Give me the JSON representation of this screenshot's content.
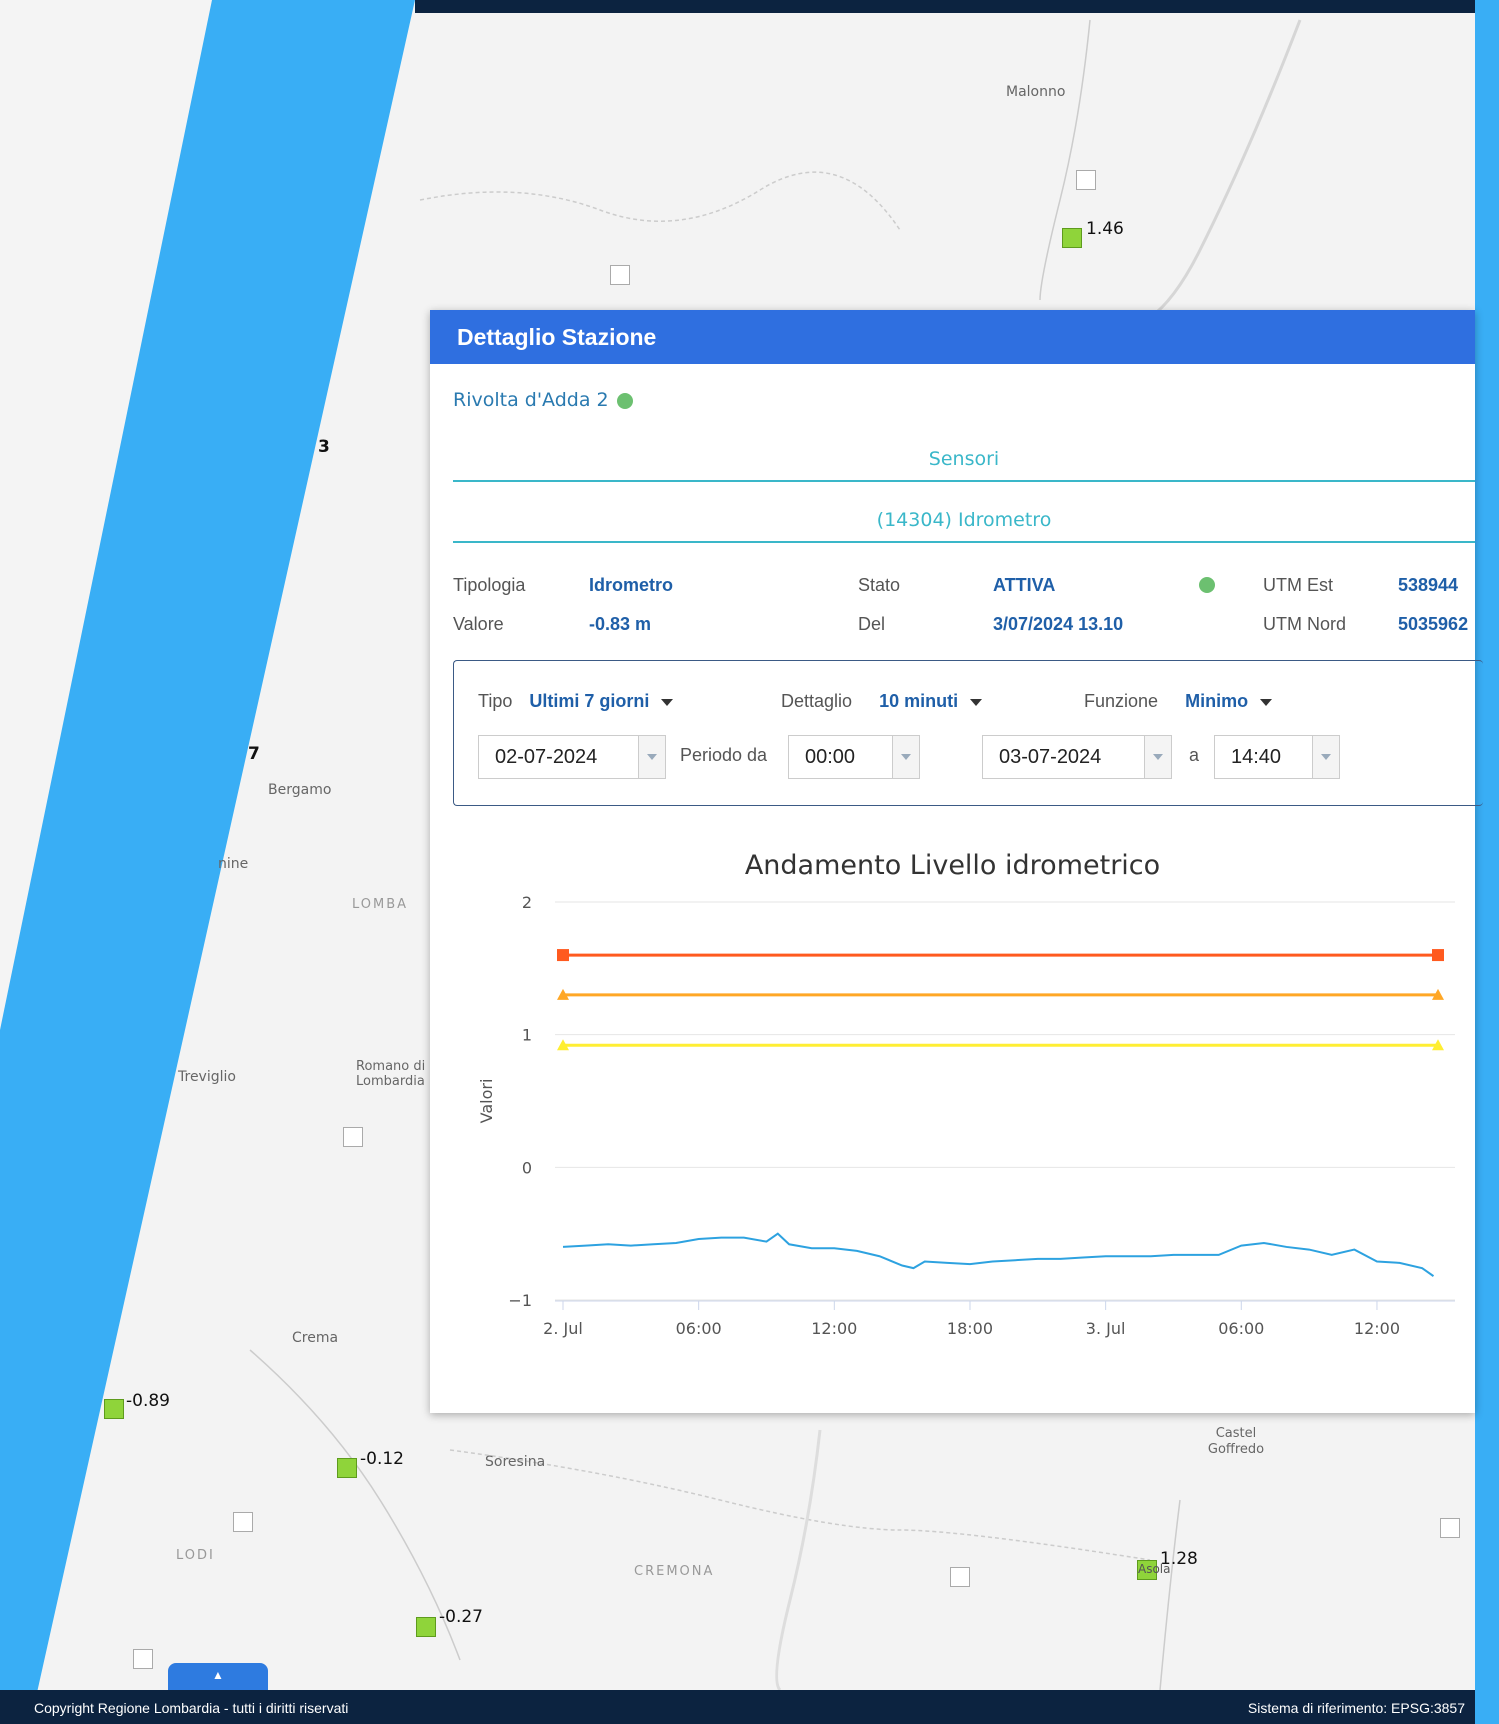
{
  "map": {
    "labels": [
      {
        "id": "malonno",
        "text": "Malonno"
      },
      {
        "id": "bergamo",
        "text": "Bergamo"
      },
      {
        "id": "treviglio",
        "text": "Treviglio"
      },
      {
        "id": "romano",
        "text": "Romano di Lombardia"
      },
      {
        "id": "crema",
        "text": "Crema"
      },
      {
        "id": "soresina",
        "text": "Soresina"
      },
      {
        "id": "castel",
        "text": "Castel Goffredo"
      },
      {
        "id": "lodi",
        "text": "LODI"
      },
      {
        "id": "cremona",
        "text": "CREMONA"
      },
      {
        "id": "lomba",
        "text": "LOMBA"
      },
      {
        "id": "nine",
        "text": "nine"
      },
      {
        "id": "asola",
        "text": "Asola"
      }
    ],
    "markers": {
      "m1": "1.46",
      "m2": "-0.89",
      "m3": "-0.12",
      "m4": "-0.27",
      "m5": "1.28",
      "e1": "3",
      "e2": "7"
    }
  },
  "panel": {
    "title": "Dettaglio Stazione",
    "station": "Rivolta d'Adda 2",
    "tab_sensori": "Sensori",
    "tab_sensor": "(14304) Idrometro",
    "info": {
      "tipologia_label": "Tipologia",
      "tipologia_value": "Idrometro",
      "stato_label": "Stato",
      "stato_value": "ATTIVA",
      "utm_est_label": "UTM Est",
      "utm_est_value": "538944",
      "valore_label": "Valore",
      "valore_value": "-0.83 m",
      "del_label": "Del",
      "del_value": "3/07/2024 13.10",
      "utm_nord_label": "UTM Nord",
      "utm_nord_value": "5035962"
    },
    "filters": {
      "tipo_label": "Tipo",
      "tipo_value": "Ultimi 7 giorni",
      "dettaglio_label": "Dettaglio",
      "dettaglio_value": "10 minuti",
      "funzione_label": "Funzione",
      "funzione_value": "Minimo",
      "date_from": "02-07-2024",
      "periodo_label": "Periodo da",
      "time_from": "00:00",
      "date_to": "03-07-2024",
      "a_label": "a",
      "time_to": "14:40"
    }
  },
  "footer": {
    "copyright": "Copyright Regione Lombardia - tutti i diritti riservati",
    "srs": "Sistema di riferimento: EPSG:3857"
  },
  "chart_data": {
    "type": "line",
    "title": "Andamento Livello idrometrico",
    "ylabel": "Valori",
    "xlabel": "",
    "ylim": [
      -1,
      2
    ],
    "yticks": [
      -1,
      0,
      1,
      2
    ],
    "xticks": [
      "2. Jul",
      "06:00",
      "12:00",
      "18:00",
      "3. Jul",
      "06:00",
      "12:00"
    ],
    "x_range_hours": [
      0,
      38.7
    ],
    "grid": true,
    "series": [
      {
        "color": "#ff5a1f",
        "marker": "square",
        "x": [
          0,
          38.7
        ],
        "values": [
          1.6,
          1.6
        ]
      },
      {
        "color": "#ffa726",
        "marker": "triangle",
        "x": [
          0,
          38.7
        ],
        "values": [
          1.3,
          1.3
        ]
      },
      {
        "color": "#ffee33",
        "marker": "triangle",
        "x": [
          0,
          38.7
        ],
        "values": [
          0.92,
          0.92
        ]
      },
      {
        "color": "#2da2e0",
        "marker": "none",
        "x": [
          0,
          1,
          2,
          3,
          4,
          5,
          6,
          7,
          8,
          9,
          9.5,
          10,
          11,
          12,
          13,
          14,
          15,
          15.5,
          16,
          17,
          18,
          19,
          20,
          21,
          22,
          23,
          24,
          25,
          26,
          27,
          28,
          29,
          30,
          31,
          32,
          33,
          34,
          35,
          36,
          37,
          38,
          38.5
        ],
        "values": [
          -0.6,
          -0.59,
          -0.58,
          -0.59,
          -0.58,
          -0.57,
          -0.54,
          -0.53,
          -0.53,
          -0.56,
          -0.5,
          -0.58,
          -0.61,
          -0.61,
          -0.63,
          -0.67,
          -0.74,
          -0.76,
          -0.71,
          -0.72,
          -0.73,
          -0.71,
          -0.7,
          -0.69,
          -0.69,
          -0.68,
          -0.67,
          -0.67,
          -0.67,
          -0.66,
          -0.66,
          -0.66,
          -0.59,
          -0.57,
          -0.6,
          -0.62,
          -0.66,
          -0.62,
          -0.71,
          -0.72,
          -0.76,
          -0.82
        ]
      }
    ]
  }
}
